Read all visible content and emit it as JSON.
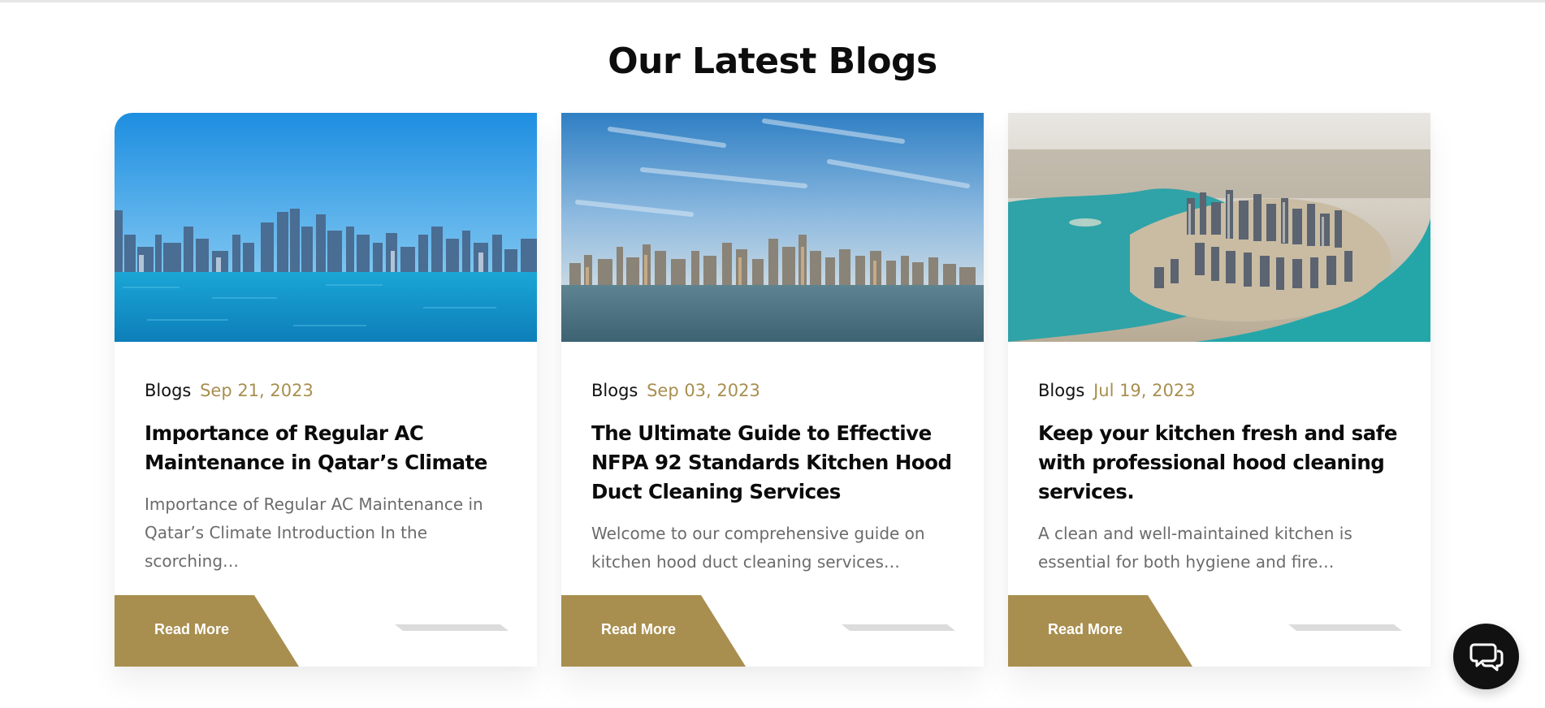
{
  "section": {
    "title": "Our Latest Blogs"
  },
  "colors": {
    "accent_gold": "#a88f4f",
    "text_dark": "#0b0b0b",
    "excerpt_gray": "#6b6b6b",
    "chat_bg": "#111111"
  },
  "posts": [
    {
      "category": "Blogs",
      "date": "Sep 21, 2023",
      "title": "Importance of Regular AC Maintenance in Qatar’s Climate",
      "excerpt": "Importance of Regular AC Maintenance in Qatar’s Climate Introduction In the scorching…",
      "read_more": "Read More",
      "image_icon": "qatar-skyline-blue-sea-image"
    },
    {
      "category": "Blogs",
      "date": "Sep 03, 2023",
      "title": "The Ultimate Guide to Effective NFPA 92 Standards Kitchen Hood Duct Cleaning Services",
      "excerpt": "Welcome to our comprehensive guide on kitchen hood duct cleaning services…",
      "read_more": "Read More",
      "image_icon": "doha-skyline-sunset-sea-image"
    },
    {
      "category": "Blogs",
      "date": "Jul 19, 2023",
      "title": "Keep your kitchen fresh and safe with professional hood cleaning services.",
      "excerpt": "A clean and well-maintained kitchen is essential for both hygiene and fire…",
      "read_more": "Read More",
      "image_icon": "aerial-doha-peninsula-image"
    }
  ],
  "chat": {
    "icon": "chat-bubbles-icon"
  }
}
